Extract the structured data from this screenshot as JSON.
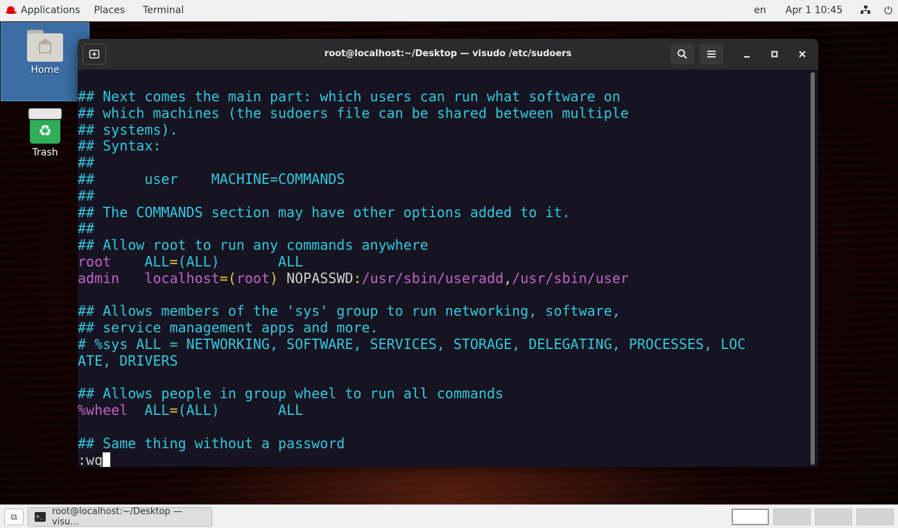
{
  "topbar": {
    "applications": "Applications",
    "places": "Places",
    "terminal": "Terminal",
    "lang": "en",
    "clock": "Apr 1  10:45"
  },
  "desktop": {
    "home_label": "Home",
    "trash_label": "Trash"
  },
  "window": {
    "title": "root@localhost:~/Desktop — visudo /etc/sudoers"
  },
  "terminal": {
    "lines": [
      [
        {
          "t": "## Next comes the main part: which users can run what software on",
          "c": "c"
        }
      ],
      [
        {
          "t": "## which machines (the sudoers file can be shared between multiple",
          "c": "c"
        }
      ],
      [
        {
          "t": "## systems).",
          "c": "c"
        }
      ],
      [
        {
          "t": "## Syntax:",
          "c": "c"
        }
      ],
      [
        {
          "t": "##",
          "c": "c"
        }
      ],
      [
        {
          "t": "##      user    MACHINE=COMMANDS",
          "c": "c"
        }
      ],
      [
        {
          "t": "##",
          "c": "c"
        }
      ],
      [
        {
          "t": "## The COMMANDS section may have other options added to it.",
          "c": "c"
        }
      ],
      [
        {
          "t": "##",
          "c": "c"
        }
      ],
      [
        {
          "t": "## Allow root to run any commands anywhere",
          "c": "c"
        }
      ],
      [
        {
          "t": "root",
          "c": "m"
        },
        {
          "t": "    ALL",
          "c": "c"
        },
        {
          "t": "=",
          "c": "y"
        },
        {
          "t": "(ALL)",
          "c": "c"
        },
        {
          "t": "       ALL",
          "c": "c"
        }
      ],
      [
        {
          "t": "admin",
          "c": "m"
        },
        {
          "t": "   localhost",
          "c": "m"
        },
        {
          "t": "=",
          "c": "y"
        },
        {
          "t": "(",
          "c": "y"
        },
        {
          "t": "root",
          "c": "m"
        },
        {
          "t": ")",
          "c": "y"
        },
        {
          "t": " NOPASSWD",
          "c": "w"
        },
        {
          "t": ":",
          "c": "y"
        },
        {
          "t": "/usr/sbin/useradd",
          "c": "m"
        },
        {
          "t": ",",
          "c": "w"
        },
        {
          "t": "/usr/sbin/user",
          "c": "m"
        }
      ],
      [
        {
          "t": "",
          "c": "w"
        }
      ],
      [
        {
          "t": "## Allows members of the 'sys' group to run networking, software,",
          "c": "c"
        }
      ],
      [
        {
          "t": "## service management apps and more.",
          "c": "c"
        }
      ],
      [
        {
          "t": "# %sys ALL = NETWORKING, SOFTWARE, SERVICES, STORAGE, DELEGATING, PROCESSES, LOC",
          "c": "c"
        }
      ],
      [
        {
          "t": "ATE, DRIVERS",
          "c": "c"
        }
      ],
      [
        {
          "t": "",
          "c": "w"
        }
      ],
      [
        {
          "t": "## Allows people in group wheel to run all commands",
          "c": "c"
        }
      ],
      [
        {
          "t": "%wheel",
          "c": "m"
        },
        {
          "t": "  ALL",
          "c": "c"
        },
        {
          "t": "=",
          "c": "y"
        },
        {
          "t": "(ALL)",
          "c": "c"
        },
        {
          "t": "       ALL",
          "c": "c"
        }
      ],
      [
        {
          "t": "",
          "c": "w"
        }
      ],
      [
        {
          "t": "## Same thing without a password",
          "c": "c"
        }
      ]
    ],
    "command": ":wq"
  },
  "taskbar": {
    "task_label": "root@localhost:~/Desktop — visu..."
  },
  "colors": {
    "comment": "#33c7de",
    "keyword": "#c061cb",
    "operator": "#e8c64a",
    "terminal_bg": "#171421"
  },
  "icons": {
    "topbar_left": "redhat-hat-icon",
    "network": "network-icon",
    "power": "power-icon",
    "new_tab": "new-tab-icon",
    "search": "search-icon",
    "menu": "hamburger-menu-icon",
    "minimize": "minimize-icon",
    "maximize": "maximize-icon",
    "close": "close-icon",
    "home": "home-folder-icon",
    "trash": "trash-icon",
    "show_desktop": "show-desktop-icon",
    "task_terminal": "terminal-icon"
  }
}
